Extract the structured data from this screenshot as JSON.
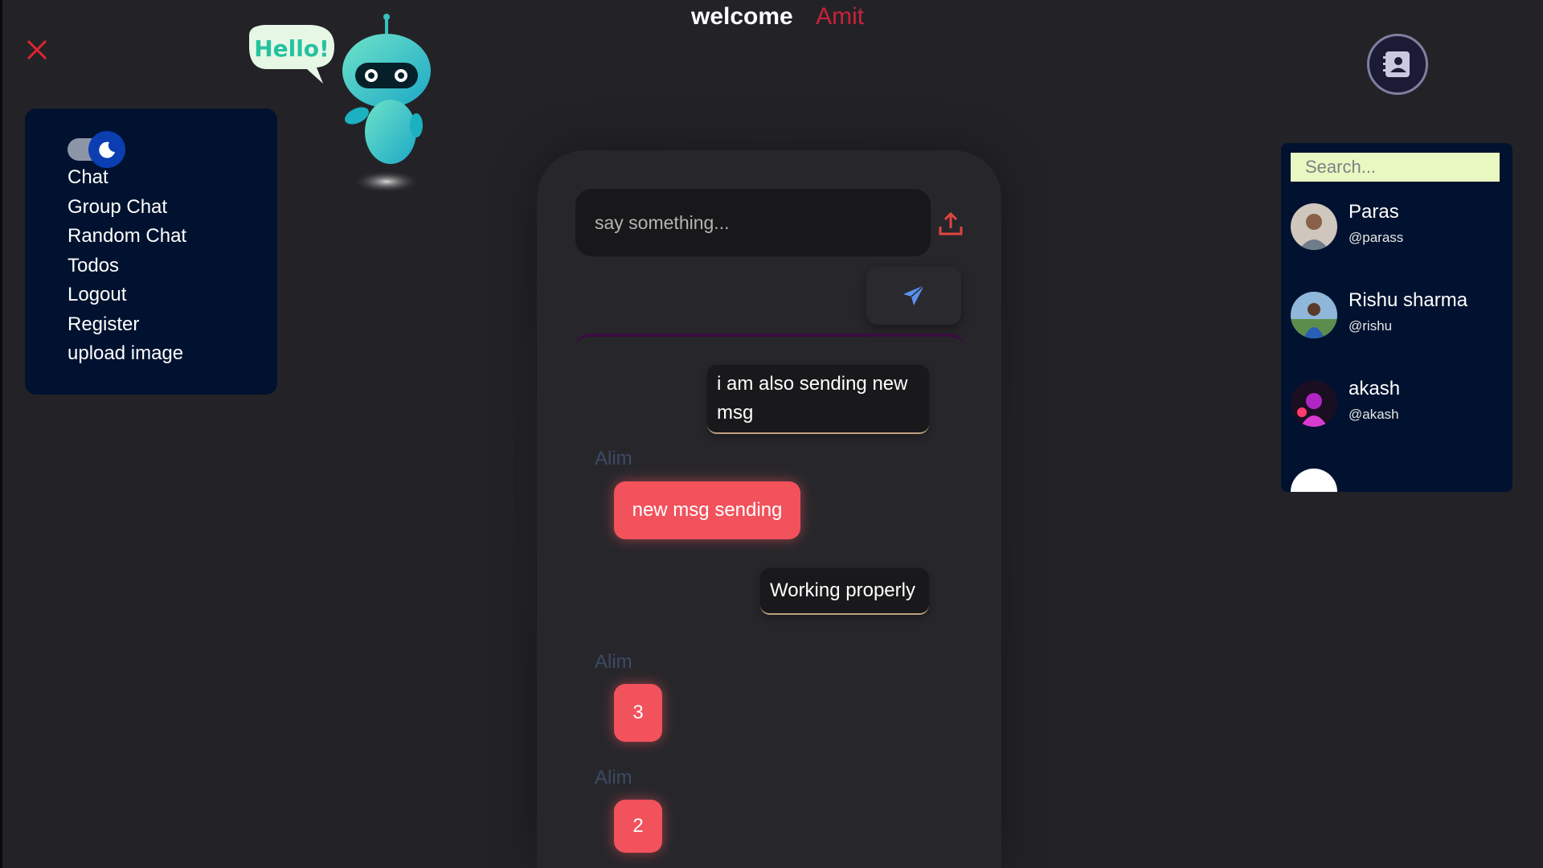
{
  "header": {
    "welcome_label": "welcome",
    "user_name": "Amit"
  },
  "menu": {
    "theme_toggle": "dark-mode-moon",
    "items": [
      {
        "label": "Chat"
      },
      {
        "label": "Group Chat"
      },
      {
        "label": "Random Chat"
      },
      {
        "label": "Todos"
      },
      {
        "label": "Logout"
      },
      {
        "label": "Register"
      },
      {
        "label": "upload image"
      }
    ]
  },
  "mascot": {
    "speech": "Hello!"
  },
  "composer": {
    "placeholder": "say something...",
    "upload_icon": "upload-icon",
    "send_icon": "paper-plane-icon"
  },
  "messages": [
    {
      "type": "sent",
      "text": "i am also sending new msg"
    },
    {
      "type": "received",
      "sender": "Alim",
      "text": "new msg sending"
    },
    {
      "type": "sent",
      "text": "Working properly"
    },
    {
      "type": "received",
      "sender": "Alim",
      "text": "3"
    },
    {
      "type": "received",
      "sender": "Alim",
      "text": "2"
    }
  ],
  "contacts": {
    "search_placeholder": "Search...",
    "list": [
      {
        "name": "Paras",
        "handle": "@parass"
      },
      {
        "name": "Rishu sharma",
        "handle": "@rishu"
      },
      {
        "name": "akash",
        "handle": "@akash"
      }
    ]
  },
  "colors": {
    "background": "#232327",
    "menu_bg": "#00122f",
    "accent_red": "#c8223b",
    "bubble_received": "#f1525c",
    "search_bg": "#e8f8c0"
  }
}
